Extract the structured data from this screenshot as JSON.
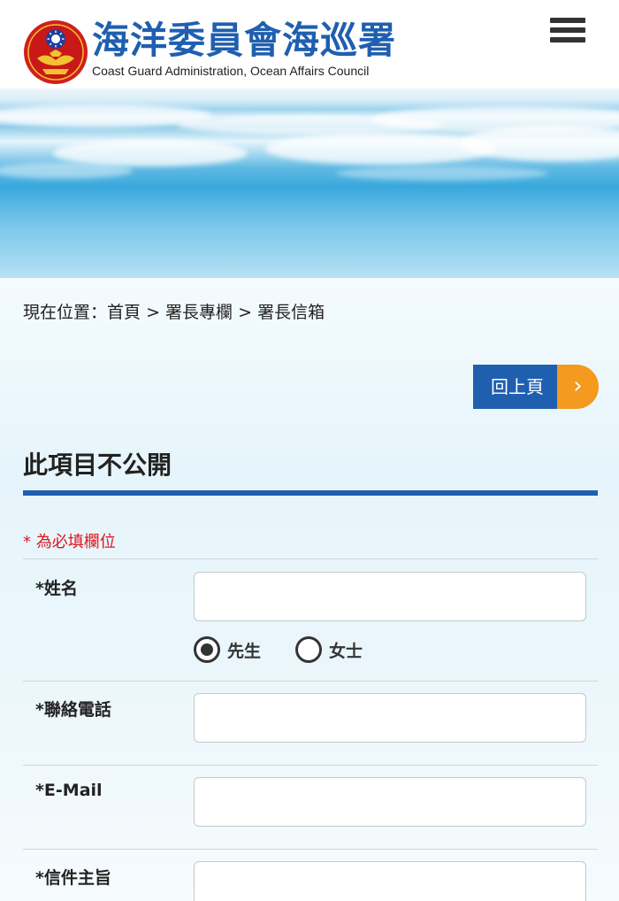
{
  "header": {
    "site_title": "海洋委員會海巡署",
    "site_subtitle": "Coast Guard Administration, Ocean Affairs Council",
    "menu_icon": "hamburger-menu-icon",
    "brand_color": "#1f5fb0"
  },
  "breadcrumb": {
    "prefix": "現在位置：",
    "items": [
      "首頁",
      "署長專欄",
      "署長信箱"
    ],
    "separator": ">"
  },
  "back_button": {
    "label": "回上頁",
    "arrow": "›",
    "accent_color": "#f39a1f"
  },
  "section": {
    "title": "此項目不公開"
  },
  "form": {
    "required_note": "* 為必填欄位",
    "fields": {
      "name": {
        "label": "*姓名",
        "value": ""
      },
      "phone": {
        "label": "*聯絡電話",
        "value": ""
      },
      "email": {
        "label": "*E-Mail",
        "value": ""
      },
      "subject": {
        "label": "*信件主旨",
        "value": ""
      }
    },
    "gender": {
      "options": [
        "先生",
        "女士"
      ],
      "selected": "先生"
    }
  }
}
